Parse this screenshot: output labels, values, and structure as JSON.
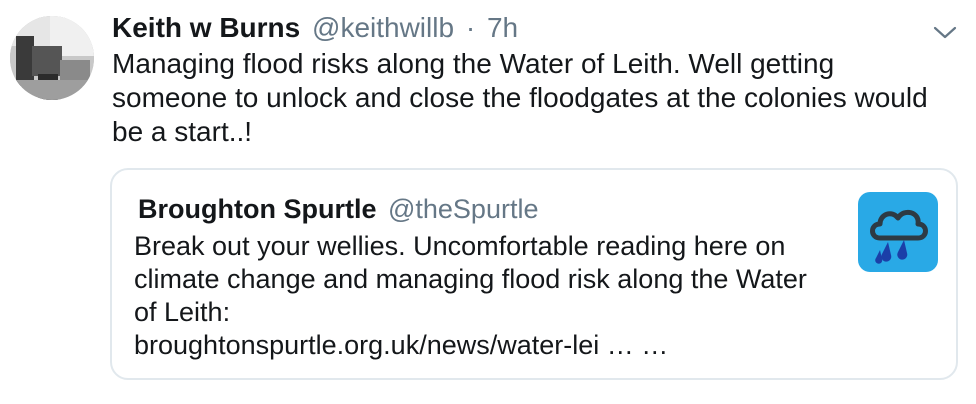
{
  "tweet": {
    "author_name": "Keith w Burns",
    "author_handle": "@keithwillb",
    "separator": "·",
    "timestamp": "7h",
    "text": "Managing flood risks along the Water of Leith. Well getting someone to unlock and close the floodgates at the colonies would be a start..!"
  },
  "quoted_tweet": {
    "author_name": "Broughton Spurtle",
    "author_handle": "@theSpurtle",
    "text": "Break out your wellies. Uncomfortable reading here on climate change and managing flood risk along the Water of Leith:",
    "link": "broughtonspurtle.org.uk/news/water-lei  … …",
    "thumbnail_icon": "rain-cloud-icon",
    "thumbnail_bg": "#29a9e6"
  },
  "icons": {
    "menu": "chevron-down-icon",
    "avatar": "user-photo"
  },
  "colors": {
    "text": "#14171a",
    "secondary": "#657786",
    "border": "#e1e8ed"
  }
}
